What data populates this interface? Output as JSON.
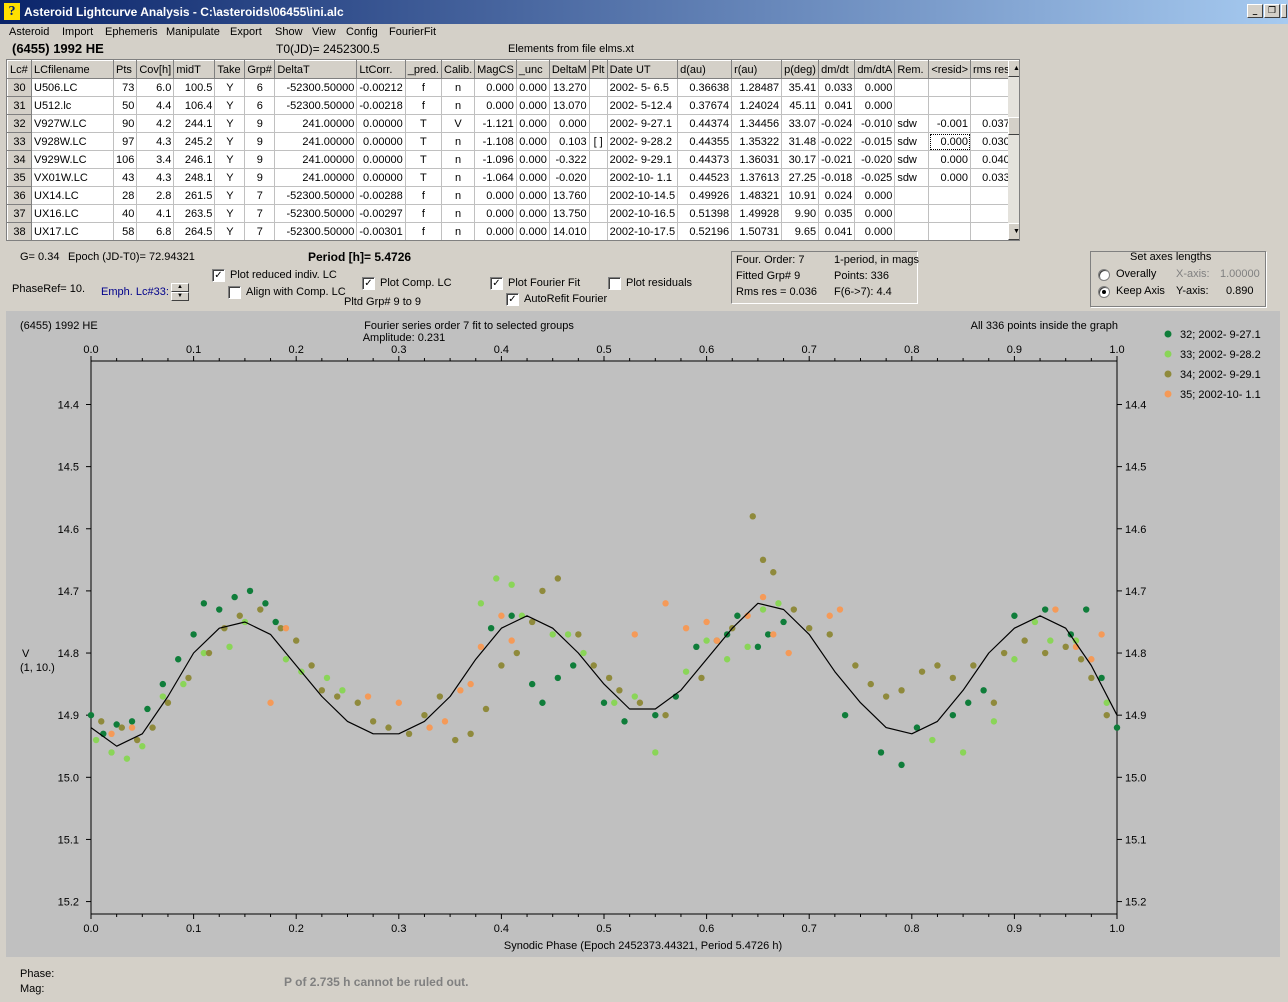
{
  "window": {
    "title": "Asteroid Lightcurve Analysis - C:\\asteroids\\06455\\ini.alc",
    "icon_label": "?",
    "buttons": [
      "_",
      "❐",
      "X"
    ]
  },
  "menu": [
    "Asteroid",
    "Import",
    "Ephemeris",
    "Manipulate",
    "Export",
    "Show",
    "View",
    "Config",
    "FourierFit"
  ],
  "header": {
    "asteroid": "(6455) 1992 HE",
    "t0": "T0(JD)= 2452300.5",
    "elements": "Elements from file elms.xt"
  },
  "table": {
    "columns": [
      "Lc#",
      "LCfilename",
      "Pts",
      "Cov[h]",
      "midT",
      "Take",
      "Grp#",
      "DeltaT",
      "LtCorr.",
      "_pred.",
      "Calib.",
      "MagCS",
      "_unc",
      "DeltaM",
      "Plt",
      "Date UT",
      "d(au)",
      "r(au)",
      "p(deg)",
      "dm/dt",
      "dm/dtA",
      "Rem.",
      "<resid>",
      "rms res"
    ],
    "rows": [
      [
        "30",
        "U506.LC",
        "73",
        "6.0",
        "100.5",
        "Y",
        "6",
        "-52300.50000",
        "-0.00212",
        "f",
        "n",
        "0.000",
        "0.000",
        "13.270",
        "",
        "2002- 5- 6.5",
        "0.36638",
        "1.28487",
        "35.41",
        "0.033",
        "0.000",
        "",
        "",
        ""
      ],
      [
        "31",
        "U512.lc",
        "50",
        "4.4",
        "106.4",
        "Y",
        "6",
        "-52300.50000",
        "-0.00218",
        "f",
        "n",
        "0.000",
        "0.000",
        "13.070",
        "",
        "2002- 5-12.4",
        "0.37674",
        "1.24024",
        "45.11",
        "0.041",
        "0.000",
        "",
        "",
        ""
      ],
      [
        "32",
        "V927W.LC",
        "90",
        "4.2",
        "244.1",
        "Y",
        "9",
        "241.00000",
        "0.00000",
        "T",
        "V",
        "-1.121",
        "0.000",
        "0.000",
        "",
        "2002- 9-27.1",
        "0.44374",
        "1.34456",
        "33.07",
        "-0.024",
        "-0.010",
        "sdw",
        "-0.001",
        "0.037"
      ],
      [
        "33",
        "V928W.LC",
        "97",
        "4.3",
        "245.2",
        "Y",
        "9",
        "241.00000",
        "0.00000",
        "T",
        "n",
        "-1.108",
        "0.000",
        "0.103",
        "[ ]",
        "2002- 9-28.2",
        "0.44355",
        "1.35322",
        "31.48",
        "-0.022",
        "-0.015",
        "sdw",
        "0.000",
        "0.030"
      ],
      [
        "34",
        "V929W.LC",
        "106",
        "3.4",
        "246.1",
        "Y",
        "9",
        "241.00000",
        "0.00000",
        "T",
        "n",
        "-1.096",
        "0.000",
        "-0.322",
        "",
        "2002- 9-29.1",
        "0.44373",
        "1.36031",
        "30.17",
        "-0.021",
        "-0.020",
        "sdw",
        "0.000",
        "0.040"
      ],
      [
        "35",
        "VX01W.LC",
        "43",
        "4.3",
        "248.1",
        "Y",
        "9",
        "241.00000",
        "0.00000",
        "T",
        "n",
        "-1.064",
        "0.000",
        "-0.020",
        "",
        "2002-10- 1.1",
        "0.44523",
        "1.37613",
        "27.25",
        "-0.018",
        "-0.025",
        "sdw",
        "0.000",
        "0.033"
      ],
      [
        "36",
        "UX14.LC",
        "28",
        "2.8",
        "261.5",
        "Y",
        "7",
        "-52300.50000",
        "-0.00288",
        "f",
        "n",
        "0.000",
        "0.000",
        "13.760",
        "",
        "2002-10-14.5",
        "0.49926",
        "1.48321",
        "10.91",
        "0.024",
        "0.000",
        "",
        "",
        ""
      ],
      [
        "37",
        "UX16.LC",
        "40",
        "4.1",
        "263.5",
        "Y",
        "7",
        "-52300.50000",
        "-0.00297",
        "f",
        "n",
        "0.000",
        "0.000",
        "13.750",
        "",
        "2002-10-16.5",
        "0.51398",
        "1.49928",
        "9.90",
        "0.035",
        "0.000",
        "",
        "",
        ""
      ],
      [
        "38",
        "UX17.LC",
        "58",
        "6.8",
        "264.5",
        "Y",
        "7",
        "-52300.50000",
        "-0.00301",
        "f",
        "n",
        "0.000",
        "0.000",
        "14.010",
        "",
        "2002-10-17.5",
        "0.52196",
        "1.50731",
        "9.65",
        "0.041",
        "0.000",
        "",
        "",
        ""
      ]
    ]
  },
  "info": {
    "g": "G= 0.34",
    "epoch": "Epoch (JD-T0)= 72.94321",
    "phaseref": "PhaseRef= 10.",
    "emph": "Emph. Lc#33:",
    "period": "Period [h]= 5.4726",
    "pltd_grp": "Pltd Grp#  9   to   9"
  },
  "checks": {
    "plot_reduced": {
      "label": "Plot reduced indiv. LC",
      "checked": true
    },
    "align_comp": {
      "label": "Align with Comp. LC",
      "checked": false
    },
    "plot_comp": {
      "label": "Plot Comp. LC",
      "checked": true
    },
    "plot_fourier": {
      "label": "Plot Fourier Fit",
      "checked": true
    },
    "autorefit": {
      "label": "AutoRefit Fourier",
      "checked": true
    },
    "plot_resid": {
      "label": "Plot residuals",
      "checked": false
    }
  },
  "fourier": {
    "order": "Four. Order:  7",
    "one_period": "1-period, in mags",
    "fitted": "Fitted Grp# 9",
    "points": "Points: 336",
    "rms": "Rms res     = 0.036",
    "ftest": "F(6->7):     4.4"
  },
  "axes_box": {
    "title": "Set axes lengths",
    "overall": "Overally",
    "keep": "Keep Axis",
    "selected": "keep",
    "xaxis_label": "X-axis:",
    "xaxis_value": "1.00000",
    "yaxis_label": "Y-axis:",
    "yaxis_value": "0.890"
  },
  "plot": {
    "top_left": "(6455) 1992 HE",
    "center_title": "Fourier series order 7 fit to selected groups",
    "amplitude": "Amplitude: 0.231",
    "top_right": "All 336 points inside the graph",
    "y_label_1": "V",
    "y_label_2": "(1, 10.)",
    "x_label": "Synodic Phase (Epoch 2452373.44321, Period 5.4726 h)"
  },
  "chart_data": {
    "type": "scatter",
    "xlim": [
      0.0,
      1.0
    ],
    "ylim": [
      15.22,
      14.33
    ],
    "y_inverted": true,
    "xticks": [
      "0.0",
      "0.1",
      "0.2",
      "0.3",
      "0.4",
      "0.5",
      "0.6",
      "0.7",
      "0.8",
      "0.9",
      "1.0"
    ],
    "yticks": [
      "14.4",
      "14.5",
      "14.6",
      "14.7",
      "14.8",
      "14.9",
      "15.0",
      "15.1",
      "15.2"
    ],
    "grid": false,
    "legend_position": "right",
    "series": [
      {
        "name": "32; 2002- 9-27.1",
        "color": "#0f7d3a",
        "x": [
          0.0,
          0.012,
          0.025,
          0.04,
          0.055,
          0.07,
          0.085,
          0.1,
          0.11,
          0.125,
          0.14,
          0.155,
          0.17,
          0.18,
          0.39,
          0.41,
          0.43,
          0.44,
          0.455,
          0.47,
          0.5,
          0.52,
          0.55,
          0.57,
          0.59,
          0.62,
          0.63,
          0.65,
          0.66,
          0.675,
          0.735,
          0.77,
          0.79,
          0.805,
          0.84,
          0.855,
          0.87,
          0.9,
          0.93,
          0.955,
          0.97,
          0.985,
          1.0
        ],
        "y": [
          14.9,
          14.93,
          14.915,
          14.91,
          14.89,
          14.85,
          14.81,
          14.77,
          14.72,
          14.73,
          14.71,
          14.7,
          14.72,
          14.75,
          14.76,
          14.74,
          14.85,
          14.88,
          14.84,
          14.82,
          14.88,
          14.91,
          14.9,
          14.87,
          14.79,
          14.77,
          14.74,
          14.79,
          14.77,
          14.75,
          14.9,
          14.96,
          14.98,
          14.92,
          14.9,
          14.88,
          14.86,
          14.74,
          14.73,
          14.77,
          14.73,
          14.84,
          14.92
        ]
      },
      {
        "name": "33; 2002- 9-28.2",
        "color": "#8ad558",
        "x": [
          0.005,
          0.02,
          0.035,
          0.05,
          0.07,
          0.09,
          0.11,
          0.135,
          0.15,
          0.19,
          0.205,
          0.23,
          0.245,
          0.38,
          0.395,
          0.41,
          0.42,
          0.45,
          0.465,
          0.48,
          0.51,
          0.53,
          0.55,
          0.58,
          0.6,
          0.62,
          0.64,
          0.655,
          0.67,
          0.82,
          0.85,
          0.88,
          0.9,
          0.92,
          0.935,
          0.96,
          0.99
        ],
        "y": [
          14.94,
          14.96,
          14.97,
          14.95,
          14.87,
          14.85,
          14.8,
          14.79,
          14.75,
          14.81,
          14.83,
          14.84,
          14.86,
          14.72,
          14.68,
          14.69,
          14.74,
          14.77,
          14.77,
          14.8,
          14.88,
          14.87,
          14.96,
          14.83,
          14.78,
          14.81,
          14.79,
          14.73,
          14.72,
          14.94,
          14.96,
          14.91,
          14.81,
          14.75,
          14.78,
          14.78,
          14.88
        ]
      },
      {
        "name": "34; 2002- 9-29.1",
        "color": "#8f8a3c",
        "x": [
          0.01,
          0.03,
          0.045,
          0.06,
          0.075,
          0.095,
          0.115,
          0.13,
          0.145,
          0.165,
          0.185,
          0.2,
          0.215,
          0.225,
          0.24,
          0.26,
          0.275,
          0.29,
          0.31,
          0.325,
          0.34,
          0.355,
          0.37,
          0.385,
          0.4,
          0.415,
          0.43,
          0.44,
          0.455,
          0.475,
          0.49,
          0.505,
          0.515,
          0.535,
          0.56,
          0.595,
          0.61,
          0.625,
          0.645,
          0.655,
          0.665,
          0.685,
          0.7,
          0.72,
          0.745,
          0.76,
          0.775,
          0.79,
          0.81,
          0.825,
          0.84,
          0.86,
          0.88,
          0.89,
          0.91,
          0.93,
          0.95,
          0.965,
          0.975,
          0.99
        ],
        "y": [
          14.91,
          14.92,
          14.94,
          14.92,
          14.88,
          14.84,
          14.8,
          14.76,
          14.74,
          14.73,
          14.76,
          14.78,
          14.82,
          14.86,
          14.87,
          14.88,
          14.91,
          14.92,
          14.93,
          14.9,
          14.87,
          14.94,
          14.93,
          14.89,
          14.82,
          14.8,
          14.75,
          14.7,
          14.68,
          14.77,
          14.82,
          14.84,
          14.86,
          14.88,
          14.9,
          14.84,
          14.78,
          14.76,
          14.58,
          14.65,
          14.67,
          14.73,
          14.76,
          14.77,
          14.82,
          14.85,
          14.87,
          14.86,
          14.83,
          14.82,
          14.84,
          14.82,
          14.88,
          14.8,
          14.78,
          14.8,
          14.79,
          14.81,
          14.84,
          14.9
        ]
      },
      {
        "name": "35; 2002-10- 1.1",
        "color": "#f59a58",
        "x": [
          0.02,
          0.04,
          0.175,
          0.19,
          0.27,
          0.3,
          0.33,
          0.345,
          0.36,
          0.37,
          0.38,
          0.4,
          0.41,
          0.53,
          0.56,
          0.58,
          0.6,
          0.61,
          0.64,
          0.655,
          0.665,
          0.68,
          0.72,
          0.73,
          0.94,
          0.96,
          0.975,
          0.985
        ],
        "y": [
          14.93,
          14.92,
          14.88,
          14.76,
          14.87,
          14.88,
          14.92,
          14.91,
          14.86,
          14.85,
          14.79,
          14.74,
          14.78,
          14.77,
          14.72,
          14.76,
          14.75,
          14.78,
          14.74,
          14.71,
          14.77,
          14.8,
          14.74,
          14.73,
          14.73,
          14.79,
          14.81,
          14.77
        ]
      }
    ],
    "fit_curve": {
      "color": "#000000",
      "x": [
        0.0,
        0.025,
        0.05,
        0.075,
        0.1,
        0.125,
        0.15,
        0.175,
        0.2,
        0.225,
        0.25,
        0.275,
        0.3,
        0.325,
        0.35,
        0.375,
        0.4,
        0.425,
        0.45,
        0.475,
        0.5,
        0.525,
        0.55,
        0.575,
        0.6,
        0.625,
        0.65,
        0.675,
        0.7,
        0.725,
        0.75,
        0.775,
        0.8,
        0.825,
        0.85,
        0.875,
        0.9,
        0.925,
        0.95,
        0.975,
        1.0
      ],
      "y": [
        14.92,
        14.95,
        14.93,
        14.87,
        14.8,
        14.76,
        14.75,
        14.77,
        14.82,
        14.87,
        14.91,
        14.93,
        14.93,
        14.91,
        14.87,
        14.81,
        14.76,
        14.74,
        14.76,
        14.8,
        14.85,
        14.89,
        14.89,
        14.86,
        14.81,
        14.76,
        14.72,
        14.73,
        14.77,
        14.83,
        14.88,
        14.92,
        14.93,
        14.91,
        14.86,
        14.8,
        14.76,
        14.74,
        14.76,
        14.82,
        14.9
      ]
    }
  }
}
